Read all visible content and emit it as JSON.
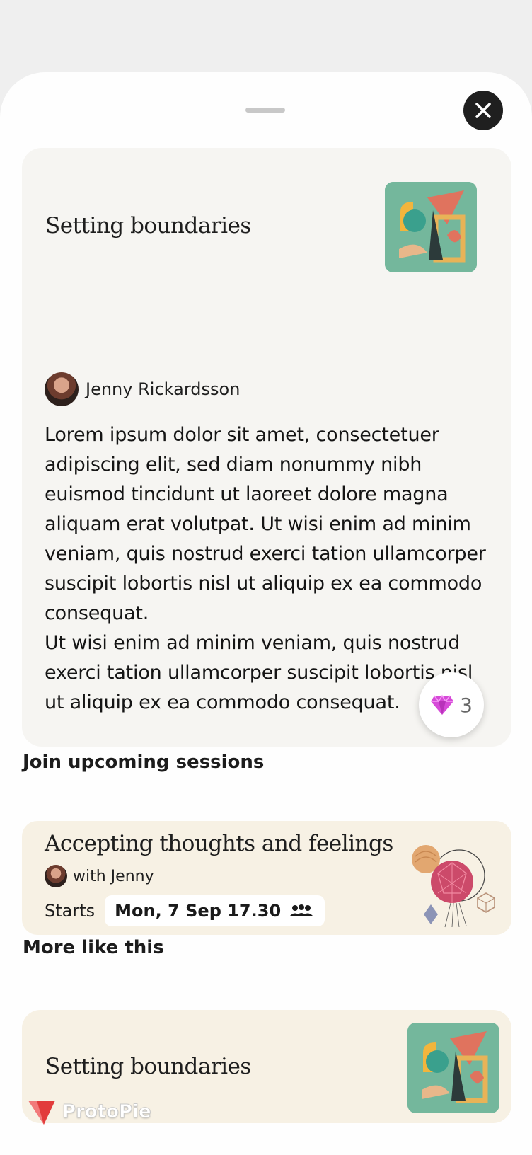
{
  "sheet": {
    "close_icon": "close-icon"
  },
  "featured": {
    "title": "Setting boundaries",
    "author": "Jenny Rickardsson",
    "description": "Lorem ipsum dolor sit amet, consectetuer adipiscing elit, sed diam nonummy nibh euismod tincidunt ut laoreet dolore magna aliquam erat volutpat. Ut wisi enim ad minim veniam, quis nostrud exerci tation ullamcorper suscipit lobortis nisl ut aliquip ex ea commodo consequat.\nUt wisi enim ad minim veniam, quis nostrud exerci tation ullamcorper suscipit lobortis nisl ut aliquip ex ea commodo consequat.",
    "gem_count": "3",
    "gem_icon": "gem-icon"
  },
  "upcoming": {
    "heading": "Join upcoming sessions",
    "session": {
      "title": "Accepting thoughts and feelings",
      "host": "with Jenny",
      "starts_label": "Starts",
      "date": "Mon, 7 Sep 17.30",
      "group_icon": "group-icon"
    }
  },
  "more": {
    "heading": "More like this",
    "item_title": "Setting boundaries"
  },
  "watermark": {
    "text": "ProtoPie"
  },
  "colors": {
    "card_main": "#f6f5f2",
    "card_session": "#f7f1e4",
    "thumb_bg": "#74b79c",
    "gem": "#d64ad8"
  }
}
